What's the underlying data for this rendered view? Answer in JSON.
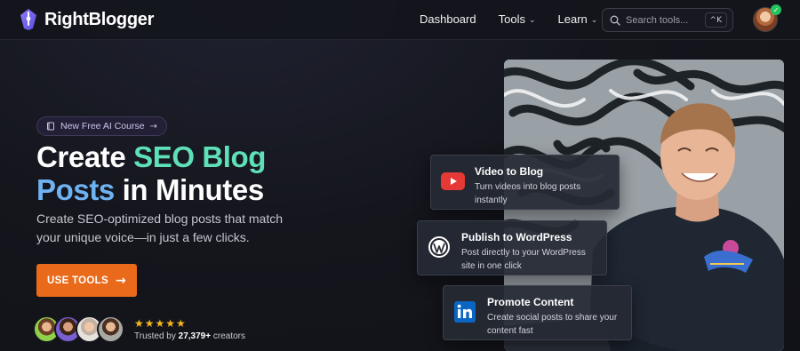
{
  "nav": {
    "brand": "RightBlogger",
    "links": [
      {
        "label": "Dashboard",
        "has_dropdown": false
      },
      {
        "label": "Tools",
        "has_dropdown": true
      },
      {
        "label": "Learn",
        "has_dropdown": true
      }
    ],
    "search_placeholder": "Search tools...",
    "shortcut": "^K"
  },
  "hero": {
    "pill_label": "New Free AI Course",
    "headline": {
      "part1": "Create ",
      "part2": "SEO Blog",
      "part3": "Posts",
      "part4": " in Minutes"
    },
    "subtitle": "Create SEO-optimized blog posts that match your unique voice—in just a few clicks.",
    "cta_label": "USE TOOLS",
    "rating_stars": "★★★★★",
    "trust_prefix": "Trusted by ",
    "trust_count": "27,379+",
    "trust_suffix": " creators"
  },
  "features": [
    {
      "title": "Video to Blog",
      "description": "Turn videos into blog posts instantly",
      "icon": "youtube-icon"
    },
    {
      "title": "Publish to WordPress",
      "description": "Post directly to your WordPress site in one click",
      "icon": "wordpress-icon"
    },
    {
      "title": "Promote Content",
      "description": "Create social posts to share your content fast",
      "icon": "linkedin-icon"
    }
  ],
  "colors": {
    "accent_orange": "#ea6a1b",
    "headline_green": "#5ee1b8",
    "headline_blue": "#6fb2f2",
    "star_gold": "#f5b81d",
    "youtube_red": "#e53935",
    "linkedin_blue": "#0a66c2"
  }
}
